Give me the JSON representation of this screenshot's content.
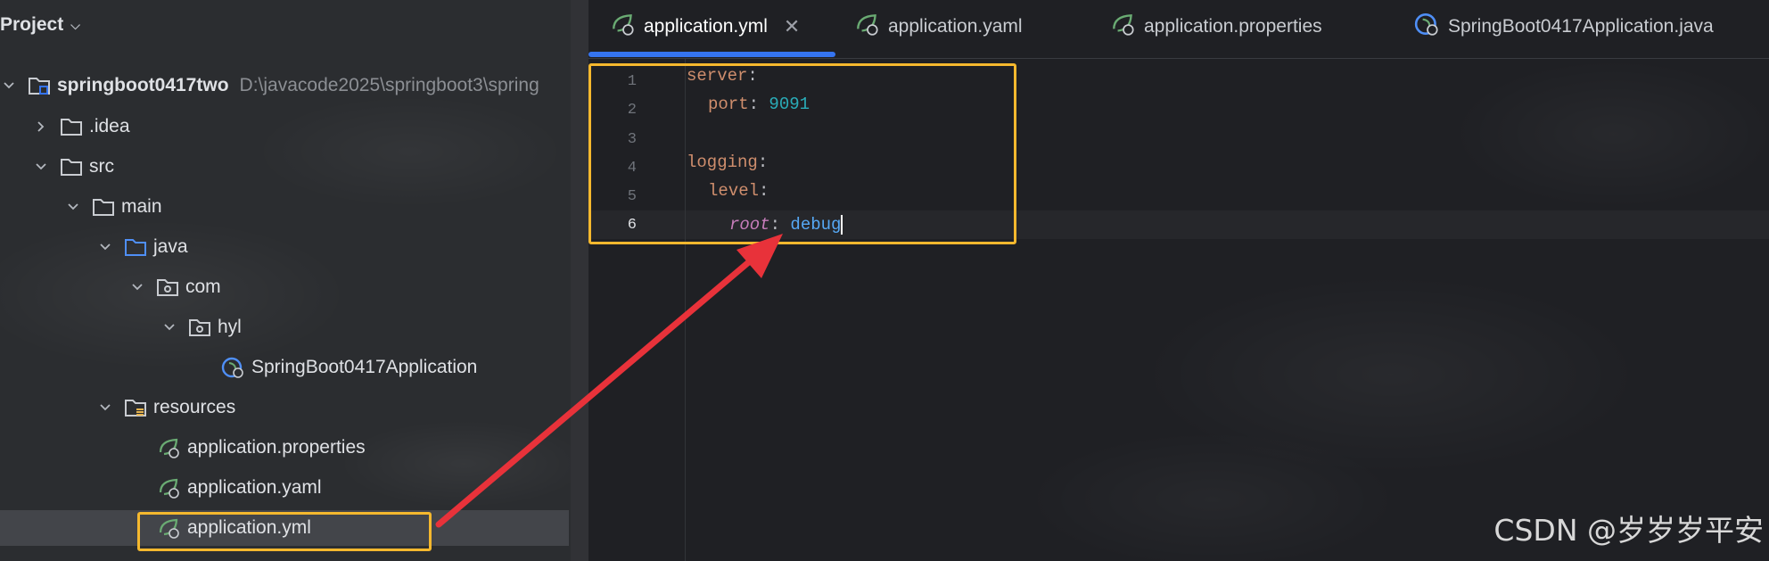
{
  "project_panel": {
    "title": "Project",
    "root": {
      "name": "springboot0417two",
      "path": "D:\\javacode2025\\springboot3\\spring"
    },
    "items": [
      {
        "label": ".idea"
      },
      {
        "label": "src"
      },
      {
        "label": "main"
      },
      {
        "label": "java"
      },
      {
        "label": "com"
      },
      {
        "label": "hyl"
      },
      {
        "label": "SpringBoot0417Application"
      },
      {
        "label": "resources"
      },
      {
        "label": "application.properties"
      },
      {
        "label": "application.yaml"
      },
      {
        "label": "application.yml"
      }
    ]
  },
  "tabs": [
    {
      "label": "application.yml",
      "active": true,
      "icon": "spring-leaf-icon"
    },
    {
      "label": "application.yaml",
      "active": false,
      "icon": "spring-leaf-icon"
    },
    {
      "label": "application.properties",
      "active": false,
      "icon": "spring-leaf-icon"
    },
    {
      "label": "SpringBoot0417Application.java",
      "active": false,
      "icon": "spring-class-icon"
    }
  ],
  "editor": {
    "line_numbers": [
      "1",
      "2",
      "3",
      "4",
      "5",
      "6"
    ],
    "lines": [
      {
        "key": "server",
        "sep": ":"
      },
      {
        "key": "port",
        "sep": ": ",
        "value": "9091"
      },
      {},
      {
        "key": "logging",
        "sep": ":"
      },
      {
        "key": "level",
        "sep": ":"
      },
      {
        "key": "root",
        "sep": ": ",
        "value": "debug"
      }
    ]
  },
  "watermark": "CSDN @岁岁岁平安",
  "colors": {
    "highlight_box": "#f5b82e",
    "arrow": "#e8323a",
    "tab_underline": "#3574f0",
    "yaml_key": "#cf8e6d",
    "yaml_number": "#2aacb8"
  }
}
